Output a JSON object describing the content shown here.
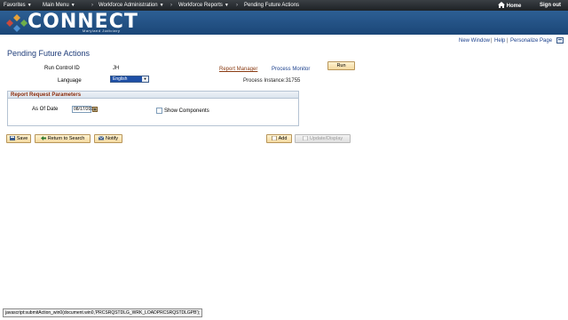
{
  "topnav": {
    "favorites": "Favorites",
    "main_menu": "Main Menu",
    "crumb_1": "Workforce Administration",
    "crumb_2": "Workforce Reports",
    "crumb_3": "Pending Future Actions",
    "home": "Home",
    "sign_out": "Sign out"
  },
  "banner": {
    "logo_text": "CONNECT",
    "logo_subtitle": "Maryland Judiciary"
  },
  "utility_links": {
    "new_window": "New Window",
    "help": "Help",
    "personalize_page": "Personalize Page"
  },
  "page": {
    "title": "Pending Future Actions",
    "run_control_id_label": "Run Control ID",
    "run_control_id_value": "JH",
    "report_manager": "Report Manager",
    "process_monitor": "Process Monitor",
    "run_button": "Run",
    "language_label": "Language",
    "language_value": "English",
    "process_instance": "Process Instance:31755"
  },
  "params": {
    "header": "Report Request Parameters",
    "as_of_date_label": "As Of Date",
    "as_of_date_value": "08/17/2015",
    "show_components_label": "Show Components"
  },
  "toolbar": {
    "save": "Save",
    "return_to_search": "Return to Search",
    "notify": "Notify",
    "add": "Add",
    "update_display": "Update/Display"
  },
  "status_bar": "javascript:submitAction_win0(document.win0,'PRCSRQSTDLG_WRK_LOADPRCSRQSTDLGPB');",
  "colors": {
    "nav_bg": "#1d2125",
    "banner_bg": "#1b4677",
    "title_blue": "#1f3d7a",
    "group_header_text": "#8a2b0a",
    "button_bg": "#f4d9a0"
  }
}
